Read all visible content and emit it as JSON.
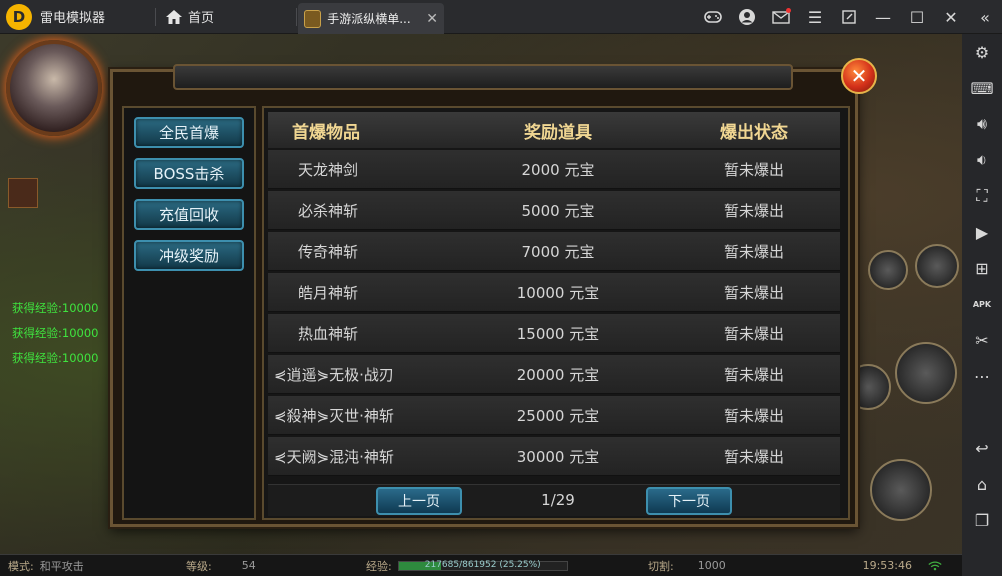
{
  "titlebar": {
    "app_name": "雷电模拟器",
    "home_tab": "首页",
    "game_tab": "手游派纵横单..."
  },
  "side_log": [
    "获得经验:10000",
    "获得经验:10000",
    "获得经验:10000"
  ],
  "dialog": {
    "categories": [
      "全民首爆",
      "BOSS击杀",
      "充值回收",
      "冲级奖励"
    ],
    "headers": [
      "首爆物品",
      "奖励道具",
      "爆出状态"
    ],
    "rows": [
      {
        "item": "天龙神剑",
        "reward": "2000 元宝",
        "status": "暂未爆出"
      },
      {
        "item": "必杀神斩",
        "reward": "5000 元宝",
        "status": "暂未爆出"
      },
      {
        "item": "传奇神斩",
        "reward": "7000 元宝",
        "status": "暂未爆出"
      },
      {
        "item": "皓月神斩",
        "reward": "10000 元宝",
        "status": "暂未爆出"
      },
      {
        "item": "热血神斩",
        "reward": "15000 元宝",
        "status": "暂未爆出"
      },
      {
        "item": "⋞逍遥⋟无极·战刃",
        "reward": "20000 元宝",
        "status": "暂未爆出"
      },
      {
        "item": "⋞殺神⋟灭世·神斩",
        "reward": "25000 元宝",
        "status": "暂未爆出"
      },
      {
        "item": "⋞天阙⋟混沌·神斩",
        "reward": "30000 元宝",
        "status": "暂未爆出"
      }
    ],
    "prev_label": "上一页",
    "next_label": "下一页",
    "page": "1/29"
  },
  "status_bar": {
    "mode_label": "模式:",
    "mode_value": "和平攻击",
    "level_label": "等级:",
    "level_value": "54",
    "exp_label": "经验:",
    "exp_value": "217685/861952 (25.25%)",
    "exp_fraction": 0.2525,
    "cut_label": "切割:",
    "cut_value": "1000",
    "time": "19:53:46"
  },
  "sidebar_icons": [
    "settings-icon",
    "keyboard-icon",
    "volume-up-icon",
    "volume-down-icon",
    "screenshot-icon",
    "record-icon",
    "add-app-icon",
    "apk-icon",
    "scissors-icon",
    "more-icon",
    "back-icon",
    "home-icon",
    "recents-icon"
  ],
  "colors": {
    "accent_gold": "#f0d692",
    "exp_green": "#3fe43f",
    "button_blue": "#2b6a82"
  }
}
